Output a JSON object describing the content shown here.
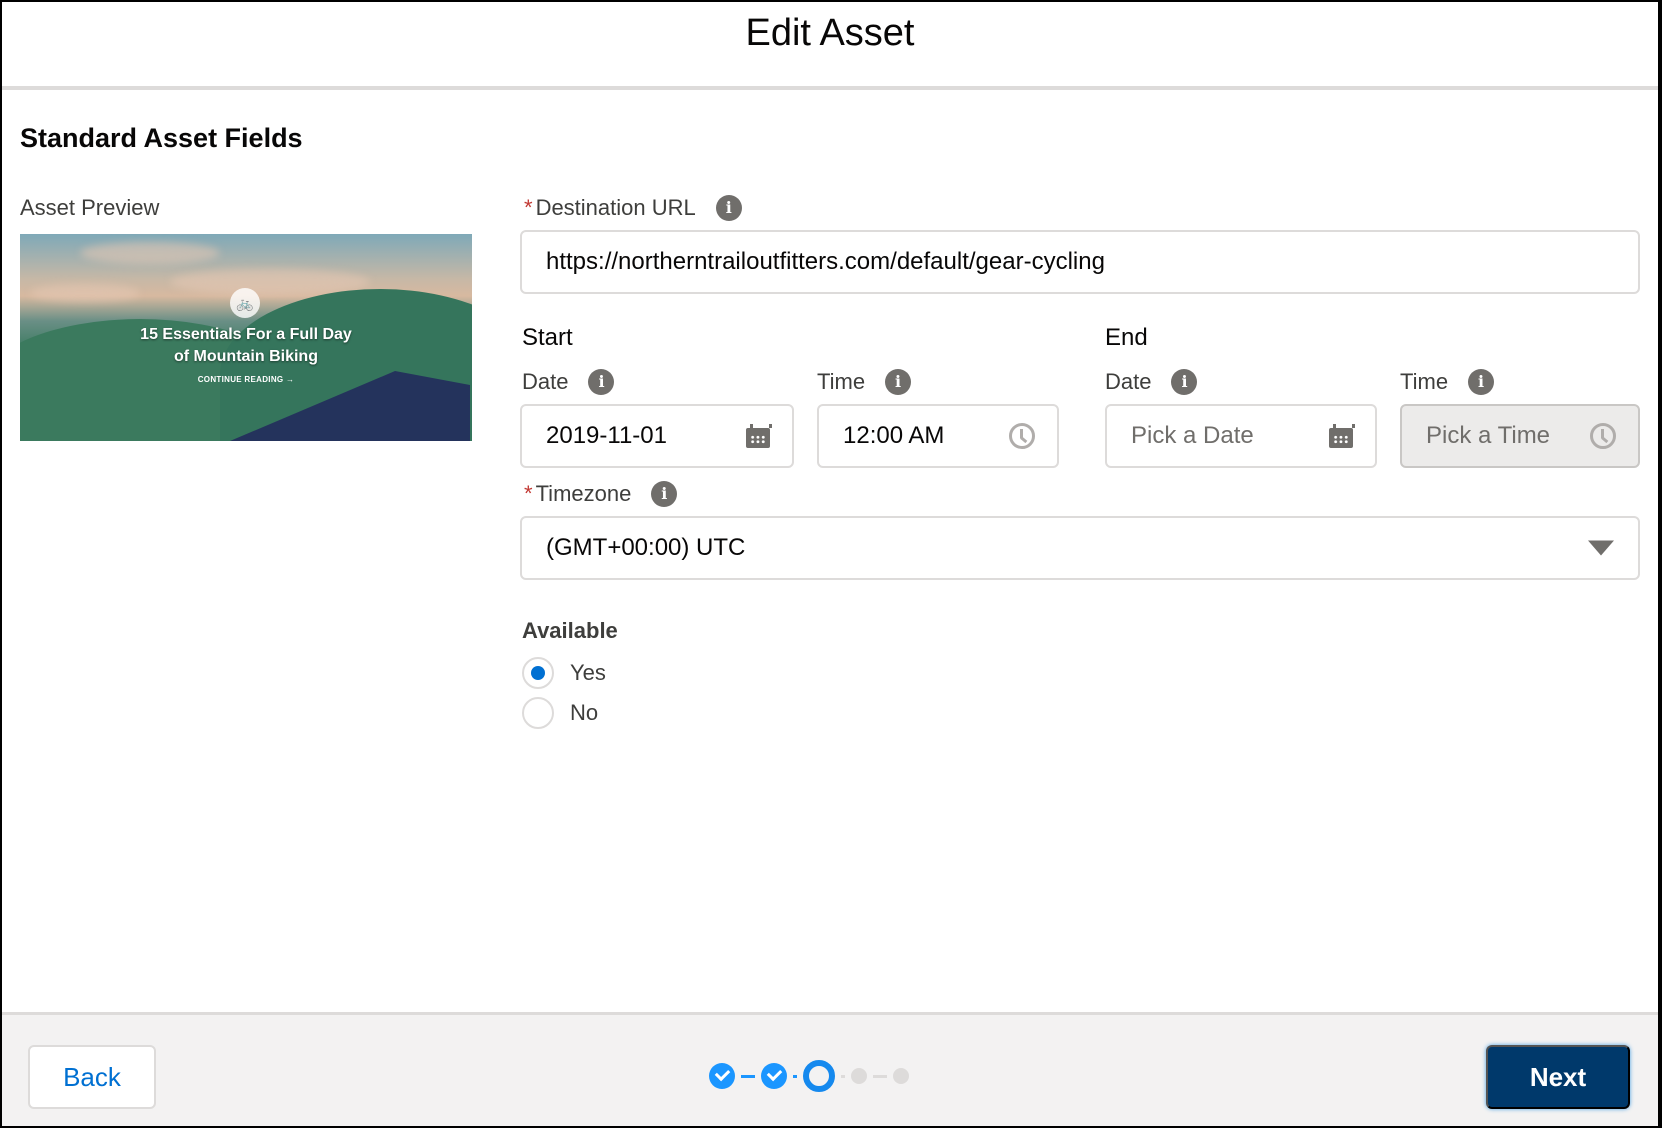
{
  "modal": {
    "title": "Edit Asset",
    "section_title": "Standard Asset Fields"
  },
  "preview": {
    "label": "Asset Preview",
    "headline_line1": "15 Essentials For a Full Day",
    "headline_line2": "of Mountain Biking",
    "cta": "CONTINUE READING →",
    "badge_icon": "bicycle-icon",
    "badge_glyph": "🚲"
  },
  "destination_url": {
    "label": "Destination URL",
    "required_marker": "*",
    "value": "https://northerntrailoutfitters.com/default/gear-cycling"
  },
  "start": {
    "group_label": "Start",
    "date_label": "Date",
    "date_value": "2019-11-01",
    "time_label": "Time",
    "time_value": "12:00 AM"
  },
  "end": {
    "group_label": "End",
    "date_label": "Date",
    "date_placeholder": "Pick a Date",
    "time_label": "Time",
    "time_placeholder": "Pick a Time",
    "time_disabled": true
  },
  "timezone": {
    "label": "Timezone",
    "required_marker": "*",
    "selected": "(GMT+00:00) UTC"
  },
  "available": {
    "label": "Available",
    "options": [
      {
        "label": "Yes",
        "checked": true
      },
      {
        "label": "No",
        "checked": false
      }
    ]
  },
  "info_glyph": "i",
  "footer": {
    "back_label": "Back",
    "next_label": "Next",
    "progress": {
      "total_steps": 5,
      "completed_steps": 2,
      "current_step": 3
    },
    "colors": {
      "active": "#1b96ff",
      "inactive": "#dddbda",
      "next_button": "#00396b",
      "link": "#0070d2"
    }
  }
}
